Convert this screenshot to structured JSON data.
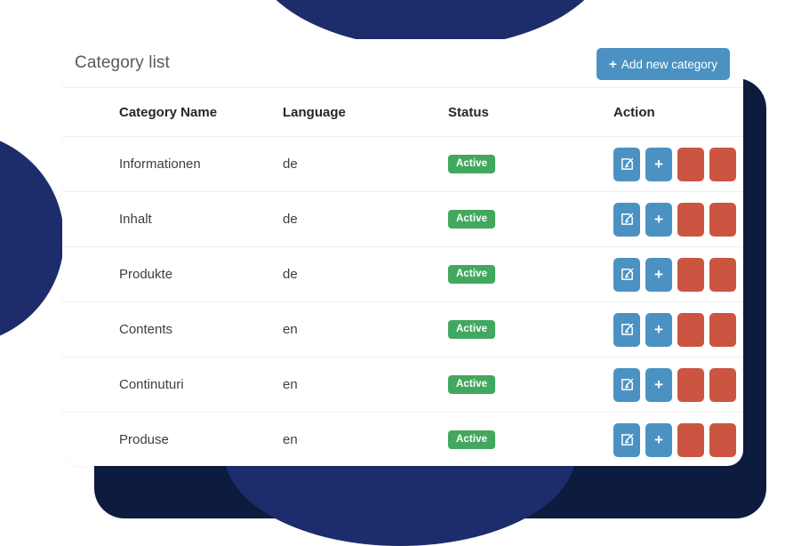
{
  "card": {
    "title": "Category list",
    "add_button": {
      "label": "Add new category",
      "icon": "plus-icon",
      "glyph": "+"
    }
  },
  "table": {
    "columns": [
      {
        "key": "name",
        "label": "Category Name"
      },
      {
        "key": "language",
        "label": "Language"
      },
      {
        "key": "status",
        "label": "Status"
      },
      {
        "key": "action",
        "label": "Action"
      }
    ],
    "rows": [
      {
        "name": "Informationen",
        "language": "de",
        "status": "Active"
      },
      {
        "name": "Inhalt",
        "language": "de",
        "status": "Active"
      },
      {
        "name": "Produkte",
        "language": "de",
        "status": "Active"
      },
      {
        "name": "Contents",
        "language": "en",
        "status": "Active"
      },
      {
        "name": "Continuturi",
        "language": "en",
        "status": "Active"
      },
      {
        "name": "Produse",
        "language": "en",
        "status": "Active"
      },
      {
        "name": "",
        "language": "",
        "status": ""
      }
    ],
    "row_actions": [
      {
        "name": "edit-button",
        "icon": "edit-square-icon",
        "style": "blue",
        "glyph": ""
      },
      {
        "name": "add-child-button",
        "icon": "plus-icon",
        "style": "blue",
        "glyph": "+"
      },
      {
        "name": "delete-button",
        "icon": "blank-icon",
        "style": "red",
        "glyph": ""
      },
      {
        "name": "remove-button",
        "icon": "blank-icon",
        "style": "red",
        "glyph": ""
      }
    ]
  },
  "colors": {
    "accent_blue": "#4b92c3",
    "accent_red": "#cc5542",
    "status_green": "#42a85f",
    "navy": "#1d2d6b",
    "navy_dark": "#0d1b3e",
    "card_bg": "#ffffff"
  }
}
